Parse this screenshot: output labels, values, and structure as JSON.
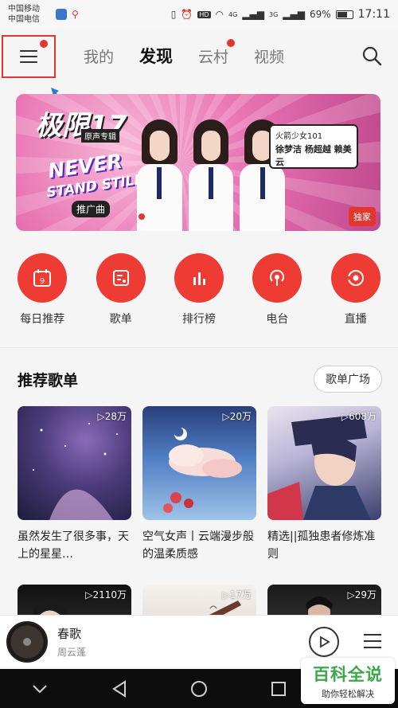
{
  "status_bar": {
    "carrier_line1": "中国移动",
    "carrier_line2": "中国电信",
    "signal_label_4g": "4G",
    "signal_label_3g": "3G",
    "hd_badge": "HD",
    "battery": "69%",
    "time": "17:11"
  },
  "nav": {
    "tabs": [
      {
        "label": "我的"
      },
      {
        "label": "发现"
      },
      {
        "label": "云村"
      },
      {
        "label": "视频"
      }
    ]
  },
  "banner": {
    "title": "极限17",
    "subtitle": "原声专辑",
    "slogan_line1": "NEVER",
    "slogan_line2": "STAND STILL",
    "song_label": "推广曲",
    "bubble_line1": "火箭少女101",
    "bubble_line2": "徐梦洁 杨超越 赖美云",
    "tag": "独家"
  },
  "quick_actions": [
    {
      "label": "每日推荐",
      "icon": "calendar-icon",
      "day": "9"
    },
    {
      "label": "歌单",
      "icon": "playlist-icon"
    },
    {
      "label": "排行榜",
      "icon": "bar-chart-icon"
    },
    {
      "label": "电台",
      "icon": "radio-icon"
    },
    {
      "label": "直播",
      "icon": "live-icon"
    }
  ],
  "recommend": {
    "title": "推荐歌单",
    "more_button": "歌单广场",
    "cards": [
      {
        "plays": "▷28万",
        "title": "虽然发生了很多事，天上的星星…"
      },
      {
        "plays": "▷20万",
        "title": "空气女声丨云端漫步般的温柔质感"
      },
      {
        "plays": "▷608万",
        "title": "精选||孤独患者修炼准则"
      }
    ],
    "cards_row2": [
      {
        "plays": "▷2110万"
      },
      {
        "plays": "▷17万"
      },
      {
        "plays": "▷29万"
      }
    ]
  },
  "player": {
    "song": "春歌",
    "artist": "周云蓬"
  },
  "watermark": {
    "main": "百科全说",
    "sub": "助你轻松解决"
  },
  "colors": {
    "accent": "#ee3b33",
    "highlight_box": "#e2362e"
  }
}
